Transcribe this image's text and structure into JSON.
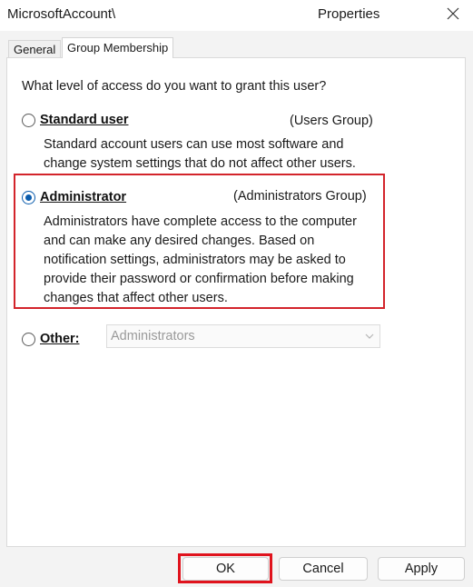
{
  "window": {
    "title_prefix": "MicrosoftAccount\\",
    "title_suffix": "Properties"
  },
  "tabs": [
    {
      "label": "General",
      "selected": false
    },
    {
      "label": "Group Membership",
      "selected": true
    }
  ],
  "question": "What level of access do you want to grant this user?",
  "options": {
    "standard": {
      "label": "Standard user",
      "group": "(Users Group)",
      "description": "Standard account users can use most software and change system settings that do not affect other users.",
      "checked": false
    },
    "administrator": {
      "label": "Administrator",
      "group": "(Administrators Group)",
      "description": "Administrators have complete access to the computer and can make any desired changes. Based on notification settings, administrators may be asked to provide their password or confirmation before making changes that affect other users.",
      "checked": true
    },
    "other": {
      "label": "Other:",
      "checked": false,
      "combo_value": "Administrators"
    }
  },
  "buttons": {
    "ok": "OK",
    "cancel": "Cancel",
    "apply": "Apply"
  },
  "colors": {
    "accent": "#0b5cad",
    "highlight": "#d3242b"
  },
  "icons": {
    "close": "close-icon",
    "dropdown": "chevron-down-icon"
  }
}
